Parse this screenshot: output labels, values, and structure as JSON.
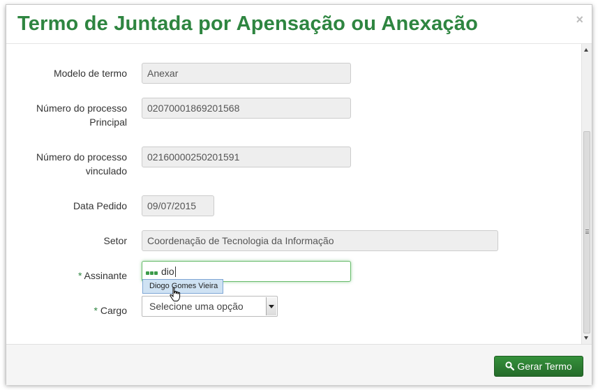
{
  "modal": {
    "title": "Termo de Juntada por Apensação ou Anexação",
    "close_label": "×"
  },
  "form": {
    "modelo": {
      "label": "Modelo de termo",
      "value": "Anexar"
    },
    "principal": {
      "label_line1": "Número do processo",
      "label_line2": "Principal",
      "value": "02070001869201568"
    },
    "vinculado": {
      "label_line1": "Número do processo",
      "label_line2": "vinculado",
      "value": "02160000250201591"
    },
    "data": {
      "label": "Data Pedido",
      "value": "09/07/2015"
    },
    "setor": {
      "label": "Setor",
      "value": "Coordenação de Tecnologia da Informação"
    },
    "assinante": {
      "required_mark": "*",
      "label": "Assinante",
      "value": "dio",
      "suggestion": "Diogo Gomes Vieira"
    },
    "cargo": {
      "required_mark": "*",
      "label": "Cargo",
      "placeholder": "Selecione uma opção"
    }
  },
  "footer": {
    "submit_label": "Gerar Termo",
    "submit_icon": "search-icon"
  },
  "colors": {
    "title": "#2e8540",
    "button": "#2e7d32"
  }
}
